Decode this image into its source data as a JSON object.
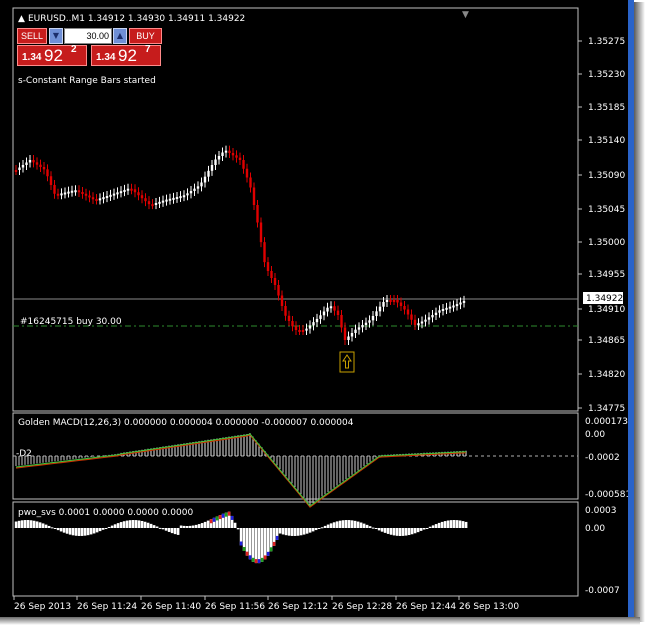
{
  "symbol_header": "EURUSD..M1  1.34912 1.34930 1.34911 1.34922",
  "trade_panel": {
    "sell_label": "SELL",
    "buy_label": "BUY",
    "lot_value": "30.00",
    "sell_price_big": "1.34",
    "sell_price_main": "92",
    "sell_price_pip": "2",
    "buy_price_big": "1.34",
    "buy_price_main": "92",
    "buy_price_pip": "7"
  },
  "status_text": "s-Constant Range Bars started",
  "order_label": "#16245715 buy 30.00",
  "current_price_label": "1.34922",
  "price_axis": [
    "1.35275",
    "1.35230",
    "1.35185",
    "1.35140",
    "1.35090",
    "1.35045",
    "1.35000",
    "1.34955",
    "1.34910",
    "1.34865",
    "1.34820",
    "1.34775"
  ],
  "macd": {
    "title": "Golden MACD(12,26,3) 0.000000 0.000004 0.000000 -0.000007 0.000004",
    "label_left": "-D2",
    "axis": [
      "0.000173",
      "0.00",
      "-0.0002",
      "-0.000581"
    ]
  },
  "pwo": {
    "title": "pwo_svs 0.0001 0.0000 0.0000 0.0000",
    "axis": [
      "0.0003",
      "0.00",
      "-0.0007"
    ]
  },
  "time_axis": [
    "26 Sep 2013",
    "26 Sep 11:24",
    "26 Sep 11:40",
    "26 Sep 11:56",
    "26 Sep 12:12",
    "26 Sep 12:28",
    "26 Sep 12:44",
    "26 Sep 13:00"
  ],
  "colors": {
    "bull": "#ffffff",
    "bear": "#e00000",
    "grid_line": "#808080",
    "order_line": "#2e8b2e",
    "macd_hist": "#ffffff",
    "macd_signal": "#c8a000",
    "macd_line": "#e0e000"
  }
}
